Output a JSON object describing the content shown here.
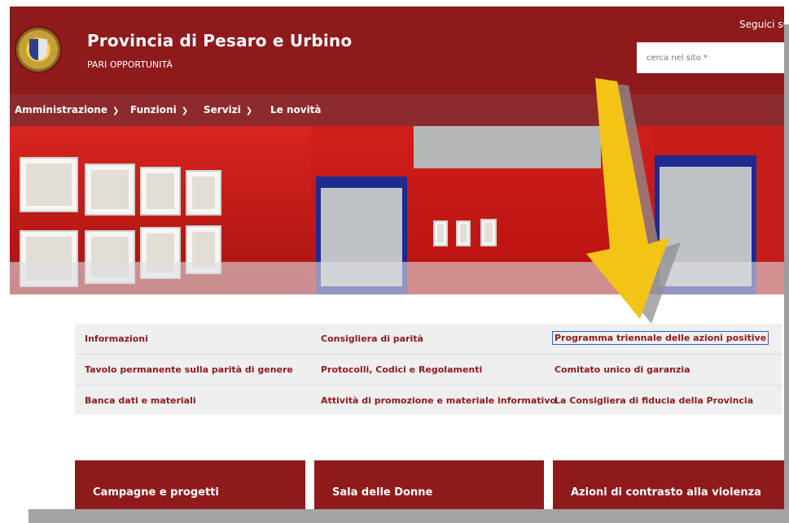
{
  "header": {
    "title": "Provincia di Pesaro e Urbino",
    "subtitle": "PARI OPPORTUNITÀ",
    "follow": "Seguici su",
    "search_placeholder": "cerca nel sito *",
    "logo_icon": "crest-logo-icon"
  },
  "nav": {
    "items": [
      {
        "label": "Amministrazione",
        "chevron": "chevron-down-icon"
      },
      {
        "label": "Funzioni",
        "chevron": "chevron-down-icon"
      },
      {
        "label": "Servizi",
        "chevron": "chevron-down-icon"
      },
      {
        "label": "Le novità"
      }
    ]
  },
  "links": {
    "rows": [
      [
        "Informazioni",
        "Consigliera di parità",
        "Programma triennale delle azioni positive"
      ],
      [
        "Tavolo permanente sulla parità di genere",
        "Protocolli, Codici e Regolamenti",
        "Comitato unico di garanzia"
      ],
      [
        "Banca dati e materiali",
        "Attività di promozione e materiale informativo",
        "La Consigliera di fiducia della Provincia"
      ]
    ]
  },
  "cards": [
    {
      "title": "Campagne e progetti"
    },
    {
      "title": "Sala delle Donne"
    },
    {
      "title": "Azioni di contrasto alla violenza"
    }
  ],
  "colors": {
    "brand": "#8e1a1c",
    "nav": "#8c2a2d",
    "arrow": "#f3c316",
    "focus": "#2965c9"
  },
  "annotation": {
    "arrow_icon": "yellow-arrow-icon"
  }
}
